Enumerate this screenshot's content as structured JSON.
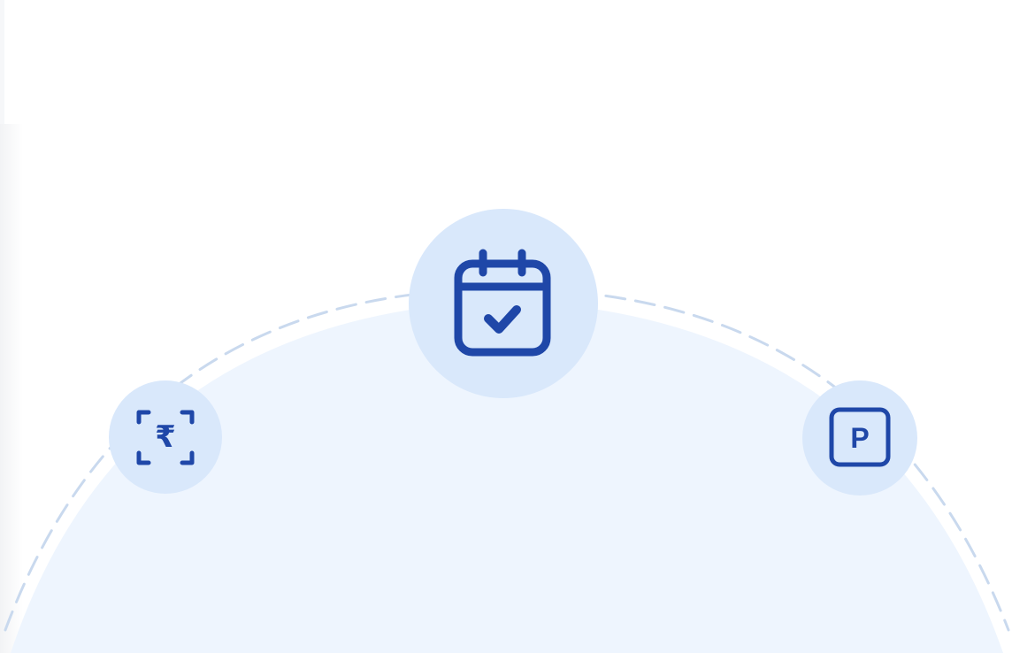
{
  "colors": {
    "background": "#ffffff",
    "dome_fill": "#eef5fe",
    "circle_fill": "#d9e8fb",
    "icon_stroke": "#1f47a8",
    "dashed_arc": "#c9d9ee"
  },
  "icons": {
    "left": {
      "name": "rupee-scan-icon",
      "glyph": "₹"
    },
    "center": {
      "name": "calendar-check-icon"
    },
    "right": {
      "name": "parking-icon",
      "glyph": "P"
    }
  }
}
